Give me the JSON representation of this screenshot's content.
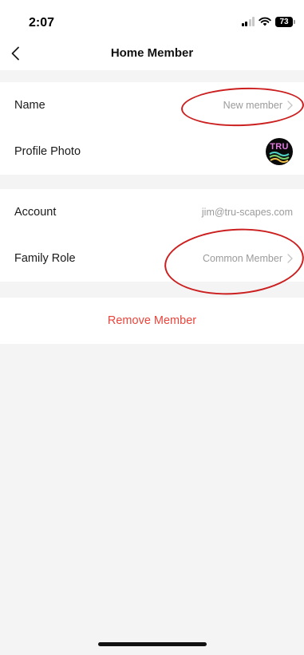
{
  "status_bar": {
    "time": "2:07",
    "battery_level": "73",
    "signal_icon": "cellular-signal-icon",
    "wifi_icon": "wifi-icon"
  },
  "nav": {
    "title": "Home Member",
    "back_icon": "chevron-left-icon"
  },
  "profile_section": {
    "name_label": "Name",
    "name_value": "New member",
    "photo_label": "Profile Photo",
    "avatar_text": "TRU"
  },
  "member_section": {
    "account_label": "Account",
    "account_value": "jim@tru-scapes.com",
    "role_label": "Family Role",
    "role_value": "Common Member"
  },
  "actions": {
    "remove_label": "Remove Member"
  },
  "colors": {
    "background": "#f4f4f5",
    "remove_text": "#e8453c",
    "annotation": "#cc1f1f"
  }
}
